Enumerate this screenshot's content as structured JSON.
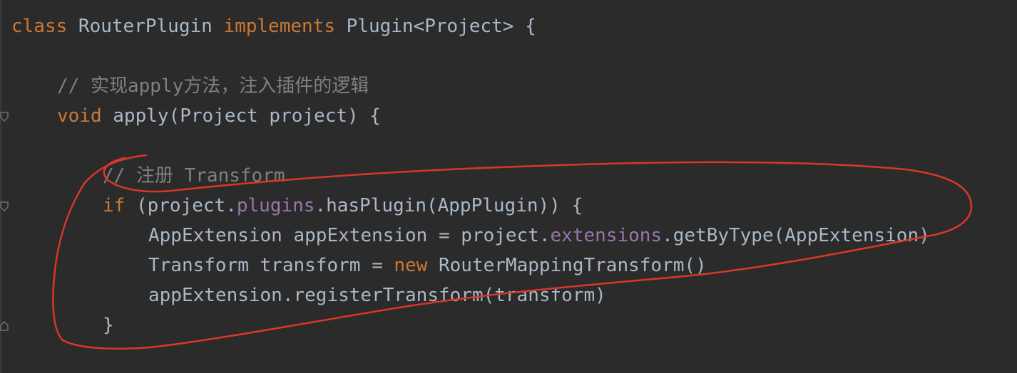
{
  "code": {
    "l1": {
      "kw_class": "class",
      "t1": " RouterPlugin ",
      "kw_impl": "implements",
      "t2": " Plugin<Project> {"
    },
    "l2": {
      "comment": "// 实现apply方法，注入插件的逻辑"
    },
    "l3": {
      "kw_void": "void",
      "t1": " apply(Project project) {"
    },
    "l4": {
      "comment": "// 注册 Transform"
    },
    "l5": {
      "kw_if": "if",
      "t1": " (project.",
      "field": "plugins",
      "t2": ".hasPlugin(AppPlugin)) {"
    },
    "l6": {
      "t1": "AppExtension appExtension = project.",
      "field": "extensions",
      "t2": ".getByType(AppExtension)"
    },
    "l7": {
      "t1": "Transform transform = ",
      "kw_new": "new",
      "t2": " RouterMappingTransform()"
    },
    "l8": {
      "t1": "appExtension.registerTransform(transform)"
    },
    "l9": {
      "t1": "}"
    }
  },
  "colors": {
    "background": "#2b2b2b",
    "keyword": "#cc7832",
    "comment": "#808080",
    "field": "#9876aa",
    "text": "#a9b7c6",
    "annotation": "#d9372a"
  }
}
